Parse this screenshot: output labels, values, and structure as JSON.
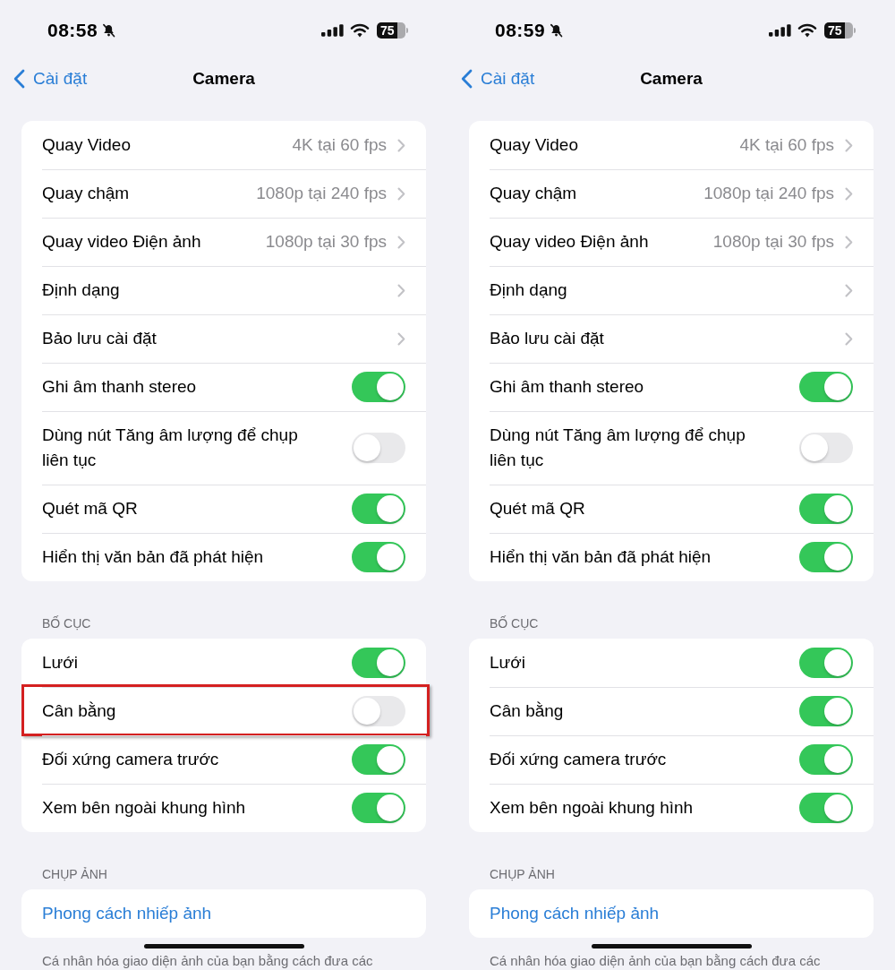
{
  "screens": [
    {
      "status_bar": {
        "time": "08:58",
        "silent": true,
        "battery": "75"
      },
      "nav": {
        "back": "Cài đặt",
        "title": "Camera"
      },
      "groups": [
        {
          "rows": [
            {
              "kind": "disclosure",
              "label": "Quay Video",
              "value": "4K tại 60 fps",
              "highlighted": false
            },
            {
              "kind": "disclosure",
              "label": "Quay chậm",
              "value": "1080p tại 240 fps",
              "highlighted": false
            },
            {
              "kind": "disclosure",
              "label": "Quay video Điện ảnh",
              "value": "1080p tại 30 fps",
              "highlighted": false
            },
            {
              "kind": "disclosure",
              "label": "Định dạng",
              "highlighted": false
            },
            {
              "kind": "disclosure",
              "label": "Bảo lưu cài đặt",
              "highlighted": false
            },
            {
              "kind": "toggle",
              "label": "Ghi âm thanh stereo",
              "on": true,
              "highlighted": false
            },
            {
              "kind": "toggle",
              "label": "Dùng nút Tăng âm lượng để chụp liên tục",
              "on": false,
              "highlighted": false
            },
            {
              "kind": "toggle",
              "label": "Quét mã QR",
              "on": true,
              "highlighted": false
            },
            {
              "kind": "toggle",
              "label": "Hiển thị văn bản đã phát hiện",
              "on": true,
              "highlighted": false
            }
          ]
        },
        {
          "header": "BỐ CỤC",
          "rows": [
            {
              "kind": "toggle",
              "label": "Lưới",
              "on": true,
              "highlighted": false
            },
            {
              "kind": "toggle",
              "label": "Cân bằng",
              "on": false,
              "highlighted": true
            },
            {
              "kind": "toggle",
              "label": "Đối xứng camera trước",
              "on": true,
              "highlighted": false
            },
            {
              "kind": "toggle",
              "label": "Xem bên ngoài khung hình",
              "on": true,
              "highlighted": false
            }
          ]
        },
        {
          "header": "CHỤP ẢNH",
          "rows": [
            {
              "kind": "link",
              "label": "Phong cách nhiếp ảnh",
              "highlighted": false
            }
          ],
          "footer": "Cá nhân hóa giao diện ảnh của bạn bằng cách đưa các"
        }
      ]
    },
    {
      "status_bar": {
        "time": "08:59",
        "silent": true,
        "battery": "75"
      },
      "nav": {
        "back": "Cài đặt",
        "title": "Camera"
      },
      "groups": [
        {
          "rows": [
            {
              "kind": "disclosure",
              "label": "Quay Video",
              "value": "4K tại 60 fps",
              "highlighted": false
            },
            {
              "kind": "disclosure",
              "label": "Quay chậm",
              "value": "1080p tại 240 fps",
              "highlighted": false
            },
            {
              "kind": "disclosure",
              "label": "Quay video Điện ảnh",
              "value": "1080p tại 30 fps",
              "highlighted": false
            },
            {
              "kind": "disclosure",
              "label": "Định dạng",
              "highlighted": false
            },
            {
              "kind": "disclosure",
              "label": "Bảo lưu cài đặt",
              "highlighted": false
            },
            {
              "kind": "toggle",
              "label": "Ghi âm thanh stereo",
              "on": true,
              "highlighted": false
            },
            {
              "kind": "toggle",
              "label": "Dùng nút Tăng âm lượng để chụp liên tục",
              "on": false,
              "highlighted": false
            },
            {
              "kind": "toggle",
              "label": "Quét mã QR",
              "on": true,
              "highlighted": false
            },
            {
              "kind": "toggle",
              "label": "Hiển thị văn bản đã phát hiện",
              "on": true,
              "highlighted": false
            }
          ]
        },
        {
          "header": "BỐ CỤC",
          "rows": [
            {
              "kind": "toggle",
              "label": "Lưới",
              "on": true,
              "highlighted": false
            },
            {
              "kind": "toggle",
              "label": "Cân bằng",
              "on": true,
              "highlighted": false
            },
            {
              "kind": "toggle",
              "label": "Đối xứng camera trước",
              "on": true,
              "highlighted": false
            },
            {
              "kind": "toggle",
              "label": "Xem bên ngoài khung hình",
              "on": true,
              "highlighted": false
            }
          ]
        },
        {
          "header": "CHỤP ẢNH",
          "rows": [
            {
              "kind": "link",
              "label": "Phong cách nhiếp ảnh",
              "highlighted": false
            }
          ],
          "footer": "Cá nhân hóa giao diện ảnh của bạn bằng cách đưa các"
        }
      ]
    }
  ]
}
